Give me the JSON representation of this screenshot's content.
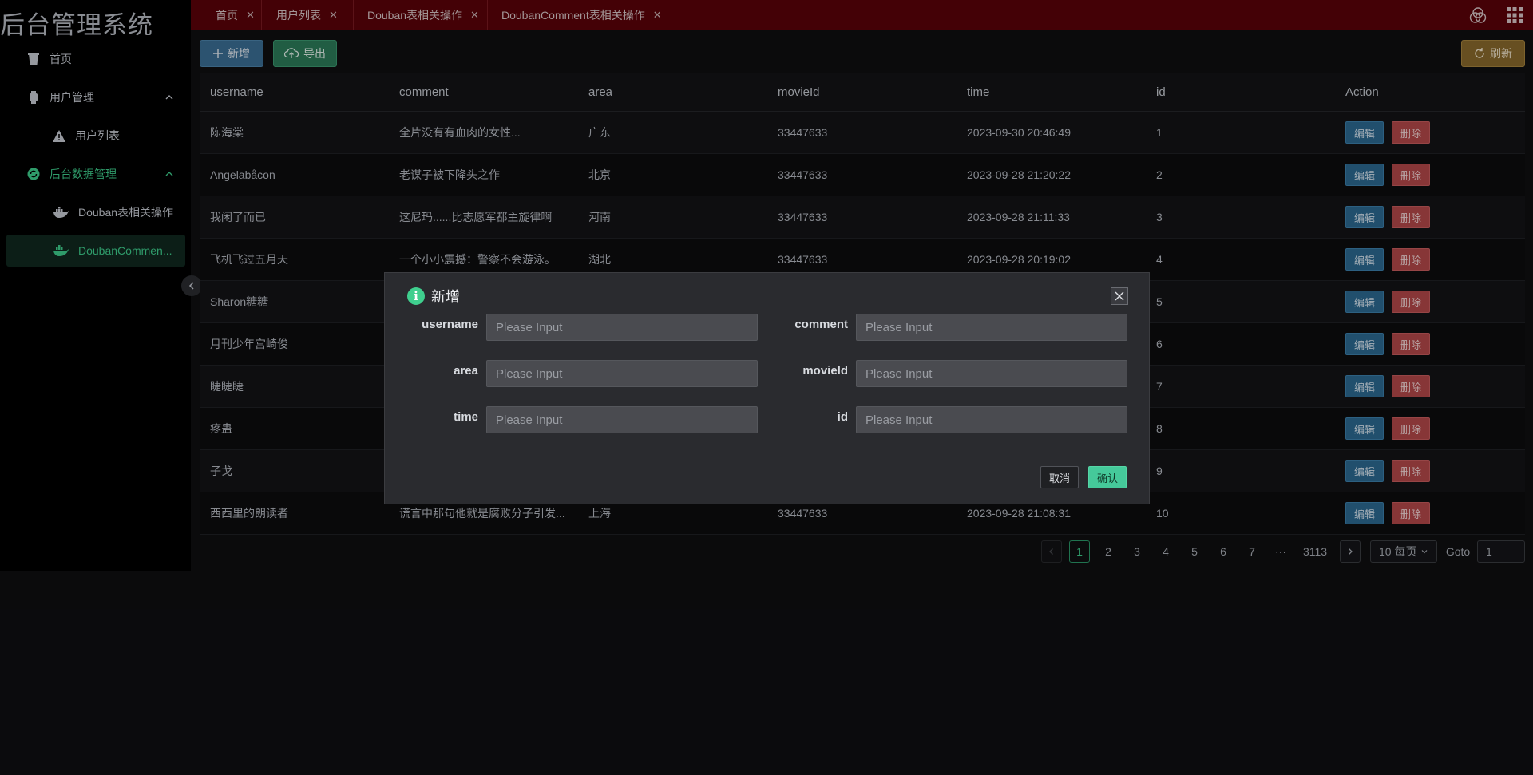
{
  "app": {
    "title": "后台管理系统"
  },
  "sidebar": {
    "items": [
      {
        "label": "首页",
        "icon": "cup-icon"
      },
      {
        "label": "用户管理",
        "icon": "watch-icon"
      },
      {
        "label": "用户列表",
        "icon": "warning-icon"
      },
      {
        "label": "后台数据管理",
        "icon": "refresh-circle-icon"
      },
      {
        "label": "Douban表相关操作",
        "icon": "docker-icon"
      },
      {
        "label": "DoubanCommen...",
        "icon": "docker-icon"
      }
    ]
  },
  "tabs": [
    {
      "label": "首页"
    },
    {
      "label": "用户列表"
    },
    {
      "label": "Douban表相关操作"
    },
    {
      "label": "DoubanComment表相关操作"
    }
  ],
  "toolbar": {
    "add_label": "新增",
    "export_label": "导出",
    "refresh_label": "刷新"
  },
  "table": {
    "headers": [
      "username",
      "comment",
      "area",
      "movieId",
      "time",
      "id",
      "Action"
    ],
    "edit_label": "编辑",
    "delete_label": "删除",
    "rows": [
      {
        "username": "陈海棠",
        "comment": "全片没有有血肉的女性...",
        "area": "广东",
        "movieId": "33447633",
        "time": "2023-09-30 20:46:49",
        "id": "1"
      },
      {
        "username": "Angelabåcon",
        "comment": "老谋子被下降头之作",
        "area": "北京",
        "movieId": "33447633",
        "time": "2023-09-28 21:20:22",
        "id": "2"
      },
      {
        "username": "我闲了而已",
        "comment": "这尼玛......比志愿军都主旋律啊",
        "area": "河南",
        "movieId": "33447633",
        "time": "2023-09-28 21:11:33",
        "id": "3"
      },
      {
        "username": "飞机飞过五月天",
        "comment": "一个小小震撼：警察不会游泳。",
        "area": "湖北",
        "movieId": "33447633",
        "time": "2023-09-28 20:19:02",
        "id": "4"
      },
      {
        "username": "Sharon糖糖",
        "comment": "",
        "area": "",
        "movieId": "",
        "time": "",
        "id": "5"
      },
      {
        "username": "月刊少年宫崎俊",
        "comment": "",
        "area": "",
        "movieId": "",
        "time": "",
        "id": "6"
      },
      {
        "username": "睫睫睫",
        "comment": "",
        "area": "",
        "movieId": "",
        "time": "",
        "id": "7"
      },
      {
        "username": "疼蛊",
        "comment": "",
        "area": "",
        "movieId": "",
        "time": "",
        "id": "8"
      },
      {
        "username": "子戈",
        "comment": "",
        "area": "",
        "movieId": "",
        "time": "",
        "id": "9"
      },
      {
        "username": "西西里的朗读者",
        "comment": "谎言中那句他就是腐败分子引发...",
        "area": "上海",
        "movieId": "33447633",
        "time": "2023-09-28 21:08:31",
        "id": "10"
      }
    ]
  },
  "pagination": {
    "pages": [
      "1",
      "2",
      "3",
      "4",
      "5",
      "6",
      "7",
      "···",
      "3113"
    ],
    "current": "1",
    "page_size": "10 每页",
    "goto_label": "Goto",
    "goto_value": "1"
  },
  "modal": {
    "title": "新增",
    "fields": [
      {
        "label": "username",
        "placeholder": "Please Input"
      },
      {
        "label": "comment",
        "placeholder": "Please Input"
      },
      {
        "label": "area",
        "placeholder": "Please Input"
      },
      {
        "label": "movieId",
        "placeholder": "Please Input"
      },
      {
        "label": "time",
        "placeholder": "Please Input"
      },
      {
        "label": "id",
        "placeholder": "Please Input"
      }
    ],
    "cancel_label": "取消",
    "confirm_label": "确认"
  }
}
